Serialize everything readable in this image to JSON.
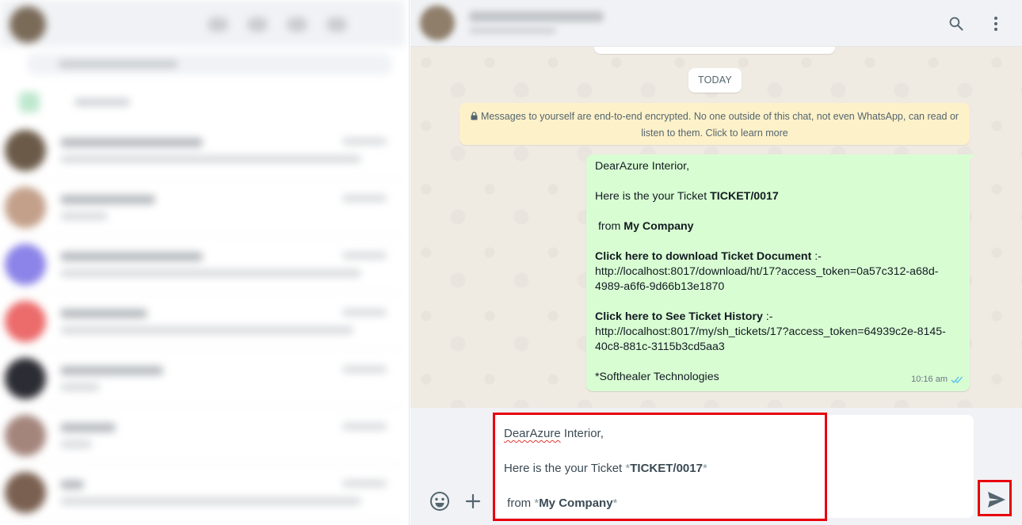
{
  "conversation": {
    "date_separator": "TODAY",
    "encryption_notice": "Messages to yourself are end-to-end encrypted. No one outside of this chat, not even WhatsApp, can read or listen to them. Click to learn more",
    "message": {
      "greeting": "DearAzure Interior,",
      "ticket_prefix": "Here is the your Ticket ",
      "ticket_number": "TICKET/0017",
      "from_prefix": " from ",
      "company": "My Company",
      "download_label": "Click here to download Ticket Document",
      "download_sep": " :-",
      "download_url_1": "http://localhost:8017/download/ht/17?access_token=0a57c312-a68d-",
      "download_url_2": "4989-a6f6-9d66b13e1870",
      "history_label": "Click here to See Ticket History",
      "history_sep": " :-",
      "history_url_1": "http://localhost:8017/my/sh_tickets/17?access_token=64939c2e-8145-",
      "history_url_2": "40c8-881c-3115b3cd5aa3",
      "signature": "*Softhealer Technologies",
      "time": "10:16 am",
      "status_icon": "double-check-icon"
    }
  },
  "composer": {
    "greeting_word": "DearAzure",
    "greeting_rest": " Interior,",
    "ticket_prefix": "Here is the your Ticket ",
    "ticket_number": "TICKET/0017",
    "from_prefix": " from ",
    "company": "My Company",
    "asterisk": "*"
  },
  "header": {
    "icons": [
      "search-icon",
      "menu-icon"
    ]
  },
  "footer": {
    "icons": [
      "emoji-icon",
      "attach-icon",
      "send-icon"
    ]
  },
  "colors": {
    "outgoing_bubble": "#d9fdd3",
    "system_notice": "#fdf1c9",
    "highlight": "#e8000e",
    "read_ticks": "#53bdeb"
  }
}
